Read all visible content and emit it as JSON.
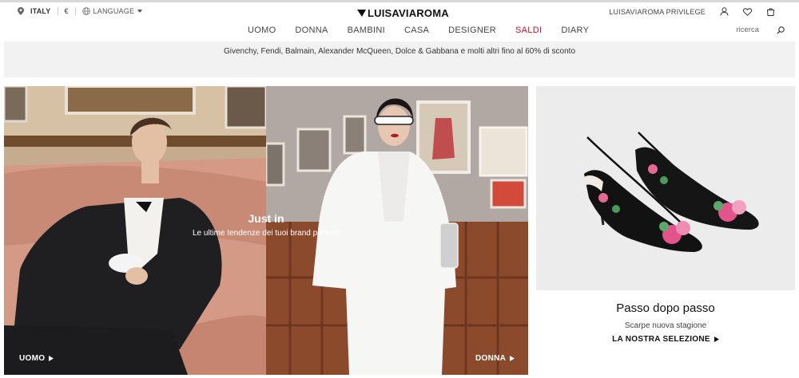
{
  "topbar": {
    "country": "ITALY",
    "currency": "€",
    "language": "LANGUAGE",
    "logo": "LUISAVIAROMA",
    "privilege": "LUISAVIAROMA PRIVILEGE"
  },
  "nav": {
    "items": [
      "UOMO",
      "DONNA",
      "BAMBINI",
      "CASA",
      "DESIGNER",
      "SALDI",
      "DIARY"
    ],
    "sale_color": "#c8102e",
    "search_placeholder": "ricerca"
  },
  "promo": {
    "text": "Givenchy, Fendi, Balmain, Alexander McQueen, Dolce & Gabbana e molti altri fino al 60% di sconto"
  },
  "hero": {
    "title": "Just in",
    "subtitle": "Le ultime tendenze dei tuoi brand preferiti",
    "left_link": "UOMO",
    "right_link": "DONNA"
  },
  "product": {
    "title": "Passo dopo passo",
    "subtitle": "Scarpe nuova stagione",
    "cta": "LA NOSTRA SELEZIONE"
  },
  "icons": [
    "location-pin-icon",
    "globe-icon",
    "caret-down-icon",
    "user-icon",
    "heart-icon",
    "bag-icon",
    "search-icon",
    "play-arrow-icon"
  ]
}
